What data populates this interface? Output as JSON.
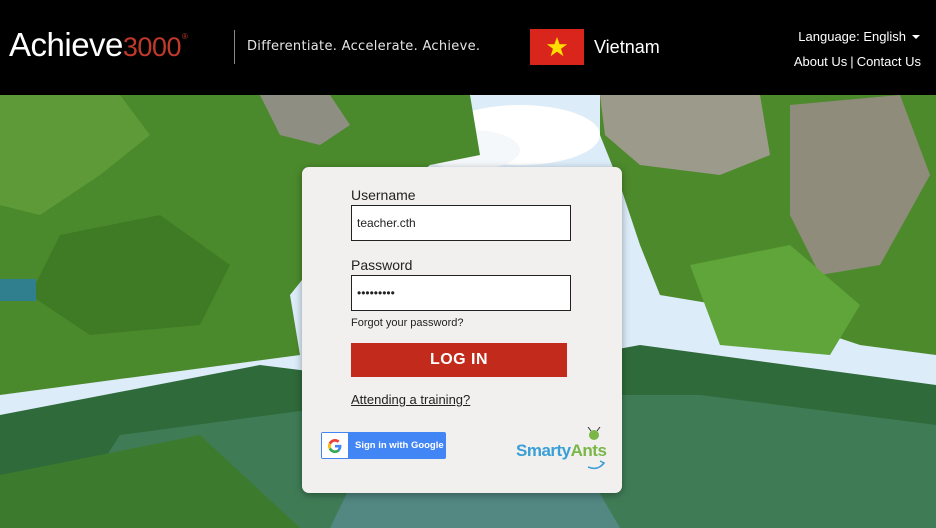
{
  "header": {
    "logo_main": "Achieve",
    "logo_number": "3000",
    "logo_reg": "®",
    "tagline": "Differentiate. Accelerate. Achieve.",
    "country": "Vietnam",
    "language_label": "Language: English",
    "about_label": "About Us",
    "separator": "|",
    "contact_label": "Contact Us"
  },
  "login": {
    "username_label": "Username",
    "username_value": "teacher.cth",
    "password_label": "Password",
    "password_value": "•••••••••",
    "forgot_label": "Forgot your password?",
    "login_button": "LOG IN",
    "training_link": "Attending a training?",
    "google_button": "Sign in with Google",
    "smarty_part1": "Smarty",
    "smarty_part2": "Ants"
  },
  "colors": {
    "accent_red": "#c22a1c",
    "flag_red": "#da251d",
    "flag_star": "#ffde00",
    "google_blue": "#4285f4"
  },
  "icons": [
    "vietnam-flag-icon",
    "chevron-down-icon",
    "google-g-icon",
    "smarty-ants-logo-icon"
  ]
}
